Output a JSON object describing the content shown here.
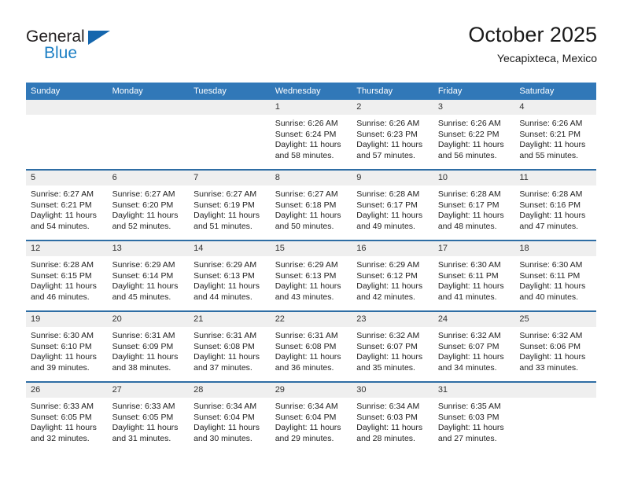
{
  "brand": {
    "name_part1": "General",
    "name_part2": "Blue"
  },
  "header": {
    "title": "October 2025",
    "subtitle": "Yecapixteca, Mexico"
  },
  "calendar": {
    "weekday_headers": [
      "Sunday",
      "Monday",
      "Tuesday",
      "Wednesday",
      "Thursday",
      "Friday",
      "Saturday"
    ],
    "colors": {
      "header_blue": "#3178b8",
      "divider_blue": "#2e6da4",
      "daynum_gray": "#efefef",
      "logo_blue": "#1c7fc4"
    },
    "weeks": [
      [
        {
          "day": "",
          "empty": true,
          "sunrise": "",
          "sunset": "",
          "daylight": ""
        },
        {
          "day": "",
          "empty": true,
          "sunrise": "",
          "sunset": "",
          "daylight": ""
        },
        {
          "day": "",
          "empty": true,
          "sunrise": "",
          "sunset": "",
          "daylight": ""
        },
        {
          "day": "1",
          "empty": false,
          "sunrise": "Sunrise: 6:26 AM",
          "sunset": "Sunset: 6:24 PM",
          "daylight": "Daylight: 11 hours and 58 minutes."
        },
        {
          "day": "2",
          "empty": false,
          "sunrise": "Sunrise: 6:26 AM",
          "sunset": "Sunset: 6:23 PM",
          "daylight": "Daylight: 11 hours and 57 minutes."
        },
        {
          "day": "3",
          "empty": false,
          "sunrise": "Sunrise: 6:26 AM",
          "sunset": "Sunset: 6:22 PM",
          "daylight": "Daylight: 11 hours and 56 minutes."
        },
        {
          "day": "4",
          "empty": false,
          "sunrise": "Sunrise: 6:26 AM",
          "sunset": "Sunset: 6:21 PM",
          "daylight": "Daylight: 11 hours and 55 minutes."
        }
      ],
      [
        {
          "day": "5",
          "empty": false,
          "sunrise": "Sunrise: 6:27 AM",
          "sunset": "Sunset: 6:21 PM",
          "daylight": "Daylight: 11 hours and 54 minutes."
        },
        {
          "day": "6",
          "empty": false,
          "sunrise": "Sunrise: 6:27 AM",
          "sunset": "Sunset: 6:20 PM",
          "daylight": "Daylight: 11 hours and 52 minutes."
        },
        {
          "day": "7",
          "empty": false,
          "sunrise": "Sunrise: 6:27 AM",
          "sunset": "Sunset: 6:19 PM",
          "daylight": "Daylight: 11 hours and 51 minutes."
        },
        {
          "day": "8",
          "empty": false,
          "sunrise": "Sunrise: 6:27 AM",
          "sunset": "Sunset: 6:18 PM",
          "daylight": "Daylight: 11 hours and 50 minutes."
        },
        {
          "day": "9",
          "empty": false,
          "sunrise": "Sunrise: 6:28 AM",
          "sunset": "Sunset: 6:17 PM",
          "daylight": "Daylight: 11 hours and 49 minutes."
        },
        {
          "day": "10",
          "empty": false,
          "sunrise": "Sunrise: 6:28 AM",
          "sunset": "Sunset: 6:17 PM",
          "daylight": "Daylight: 11 hours and 48 minutes."
        },
        {
          "day": "11",
          "empty": false,
          "sunrise": "Sunrise: 6:28 AM",
          "sunset": "Sunset: 6:16 PM",
          "daylight": "Daylight: 11 hours and 47 minutes."
        }
      ],
      [
        {
          "day": "12",
          "empty": false,
          "sunrise": "Sunrise: 6:28 AM",
          "sunset": "Sunset: 6:15 PM",
          "daylight": "Daylight: 11 hours and 46 minutes."
        },
        {
          "day": "13",
          "empty": false,
          "sunrise": "Sunrise: 6:29 AM",
          "sunset": "Sunset: 6:14 PM",
          "daylight": "Daylight: 11 hours and 45 minutes."
        },
        {
          "day": "14",
          "empty": false,
          "sunrise": "Sunrise: 6:29 AM",
          "sunset": "Sunset: 6:13 PM",
          "daylight": "Daylight: 11 hours and 44 minutes."
        },
        {
          "day": "15",
          "empty": false,
          "sunrise": "Sunrise: 6:29 AM",
          "sunset": "Sunset: 6:13 PM",
          "daylight": "Daylight: 11 hours and 43 minutes."
        },
        {
          "day": "16",
          "empty": false,
          "sunrise": "Sunrise: 6:29 AM",
          "sunset": "Sunset: 6:12 PM",
          "daylight": "Daylight: 11 hours and 42 minutes."
        },
        {
          "day": "17",
          "empty": false,
          "sunrise": "Sunrise: 6:30 AM",
          "sunset": "Sunset: 6:11 PM",
          "daylight": "Daylight: 11 hours and 41 minutes."
        },
        {
          "day": "18",
          "empty": false,
          "sunrise": "Sunrise: 6:30 AM",
          "sunset": "Sunset: 6:11 PM",
          "daylight": "Daylight: 11 hours and 40 minutes."
        }
      ],
      [
        {
          "day": "19",
          "empty": false,
          "sunrise": "Sunrise: 6:30 AM",
          "sunset": "Sunset: 6:10 PM",
          "daylight": "Daylight: 11 hours and 39 minutes."
        },
        {
          "day": "20",
          "empty": false,
          "sunrise": "Sunrise: 6:31 AM",
          "sunset": "Sunset: 6:09 PM",
          "daylight": "Daylight: 11 hours and 38 minutes."
        },
        {
          "day": "21",
          "empty": false,
          "sunrise": "Sunrise: 6:31 AM",
          "sunset": "Sunset: 6:08 PM",
          "daylight": "Daylight: 11 hours and 37 minutes."
        },
        {
          "day": "22",
          "empty": false,
          "sunrise": "Sunrise: 6:31 AM",
          "sunset": "Sunset: 6:08 PM",
          "daylight": "Daylight: 11 hours and 36 minutes."
        },
        {
          "day": "23",
          "empty": false,
          "sunrise": "Sunrise: 6:32 AM",
          "sunset": "Sunset: 6:07 PM",
          "daylight": "Daylight: 11 hours and 35 minutes."
        },
        {
          "day": "24",
          "empty": false,
          "sunrise": "Sunrise: 6:32 AM",
          "sunset": "Sunset: 6:07 PM",
          "daylight": "Daylight: 11 hours and 34 minutes."
        },
        {
          "day": "25",
          "empty": false,
          "sunrise": "Sunrise: 6:32 AM",
          "sunset": "Sunset: 6:06 PM",
          "daylight": "Daylight: 11 hours and 33 minutes."
        }
      ],
      [
        {
          "day": "26",
          "empty": false,
          "sunrise": "Sunrise: 6:33 AM",
          "sunset": "Sunset: 6:05 PM",
          "daylight": "Daylight: 11 hours and 32 minutes."
        },
        {
          "day": "27",
          "empty": false,
          "sunrise": "Sunrise: 6:33 AM",
          "sunset": "Sunset: 6:05 PM",
          "daylight": "Daylight: 11 hours and 31 minutes."
        },
        {
          "day": "28",
          "empty": false,
          "sunrise": "Sunrise: 6:34 AM",
          "sunset": "Sunset: 6:04 PM",
          "daylight": "Daylight: 11 hours and 30 minutes."
        },
        {
          "day": "29",
          "empty": false,
          "sunrise": "Sunrise: 6:34 AM",
          "sunset": "Sunset: 6:04 PM",
          "daylight": "Daylight: 11 hours and 29 minutes."
        },
        {
          "day": "30",
          "empty": false,
          "sunrise": "Sunrise: 6:34 AM",
          "sunset": "Sunset: 6:03 PM",
          "daylight": "Daylight: 11 hours and 28 minutes."
        },
        {
          "day": "31",
          "empty": false,
          "sunrise": "Sunrise: 6:35 AM",
          "sunset": "Sunset: 6:03 PM",
          "daylight": "Daylight: 11 hours and 27 minutes."
        },
        {
          "day": "",
          "empty": true,
          "sunrise": "",
          "sunset": "",
          "daylight": ""
        }
      ]
    ]
  }
}
